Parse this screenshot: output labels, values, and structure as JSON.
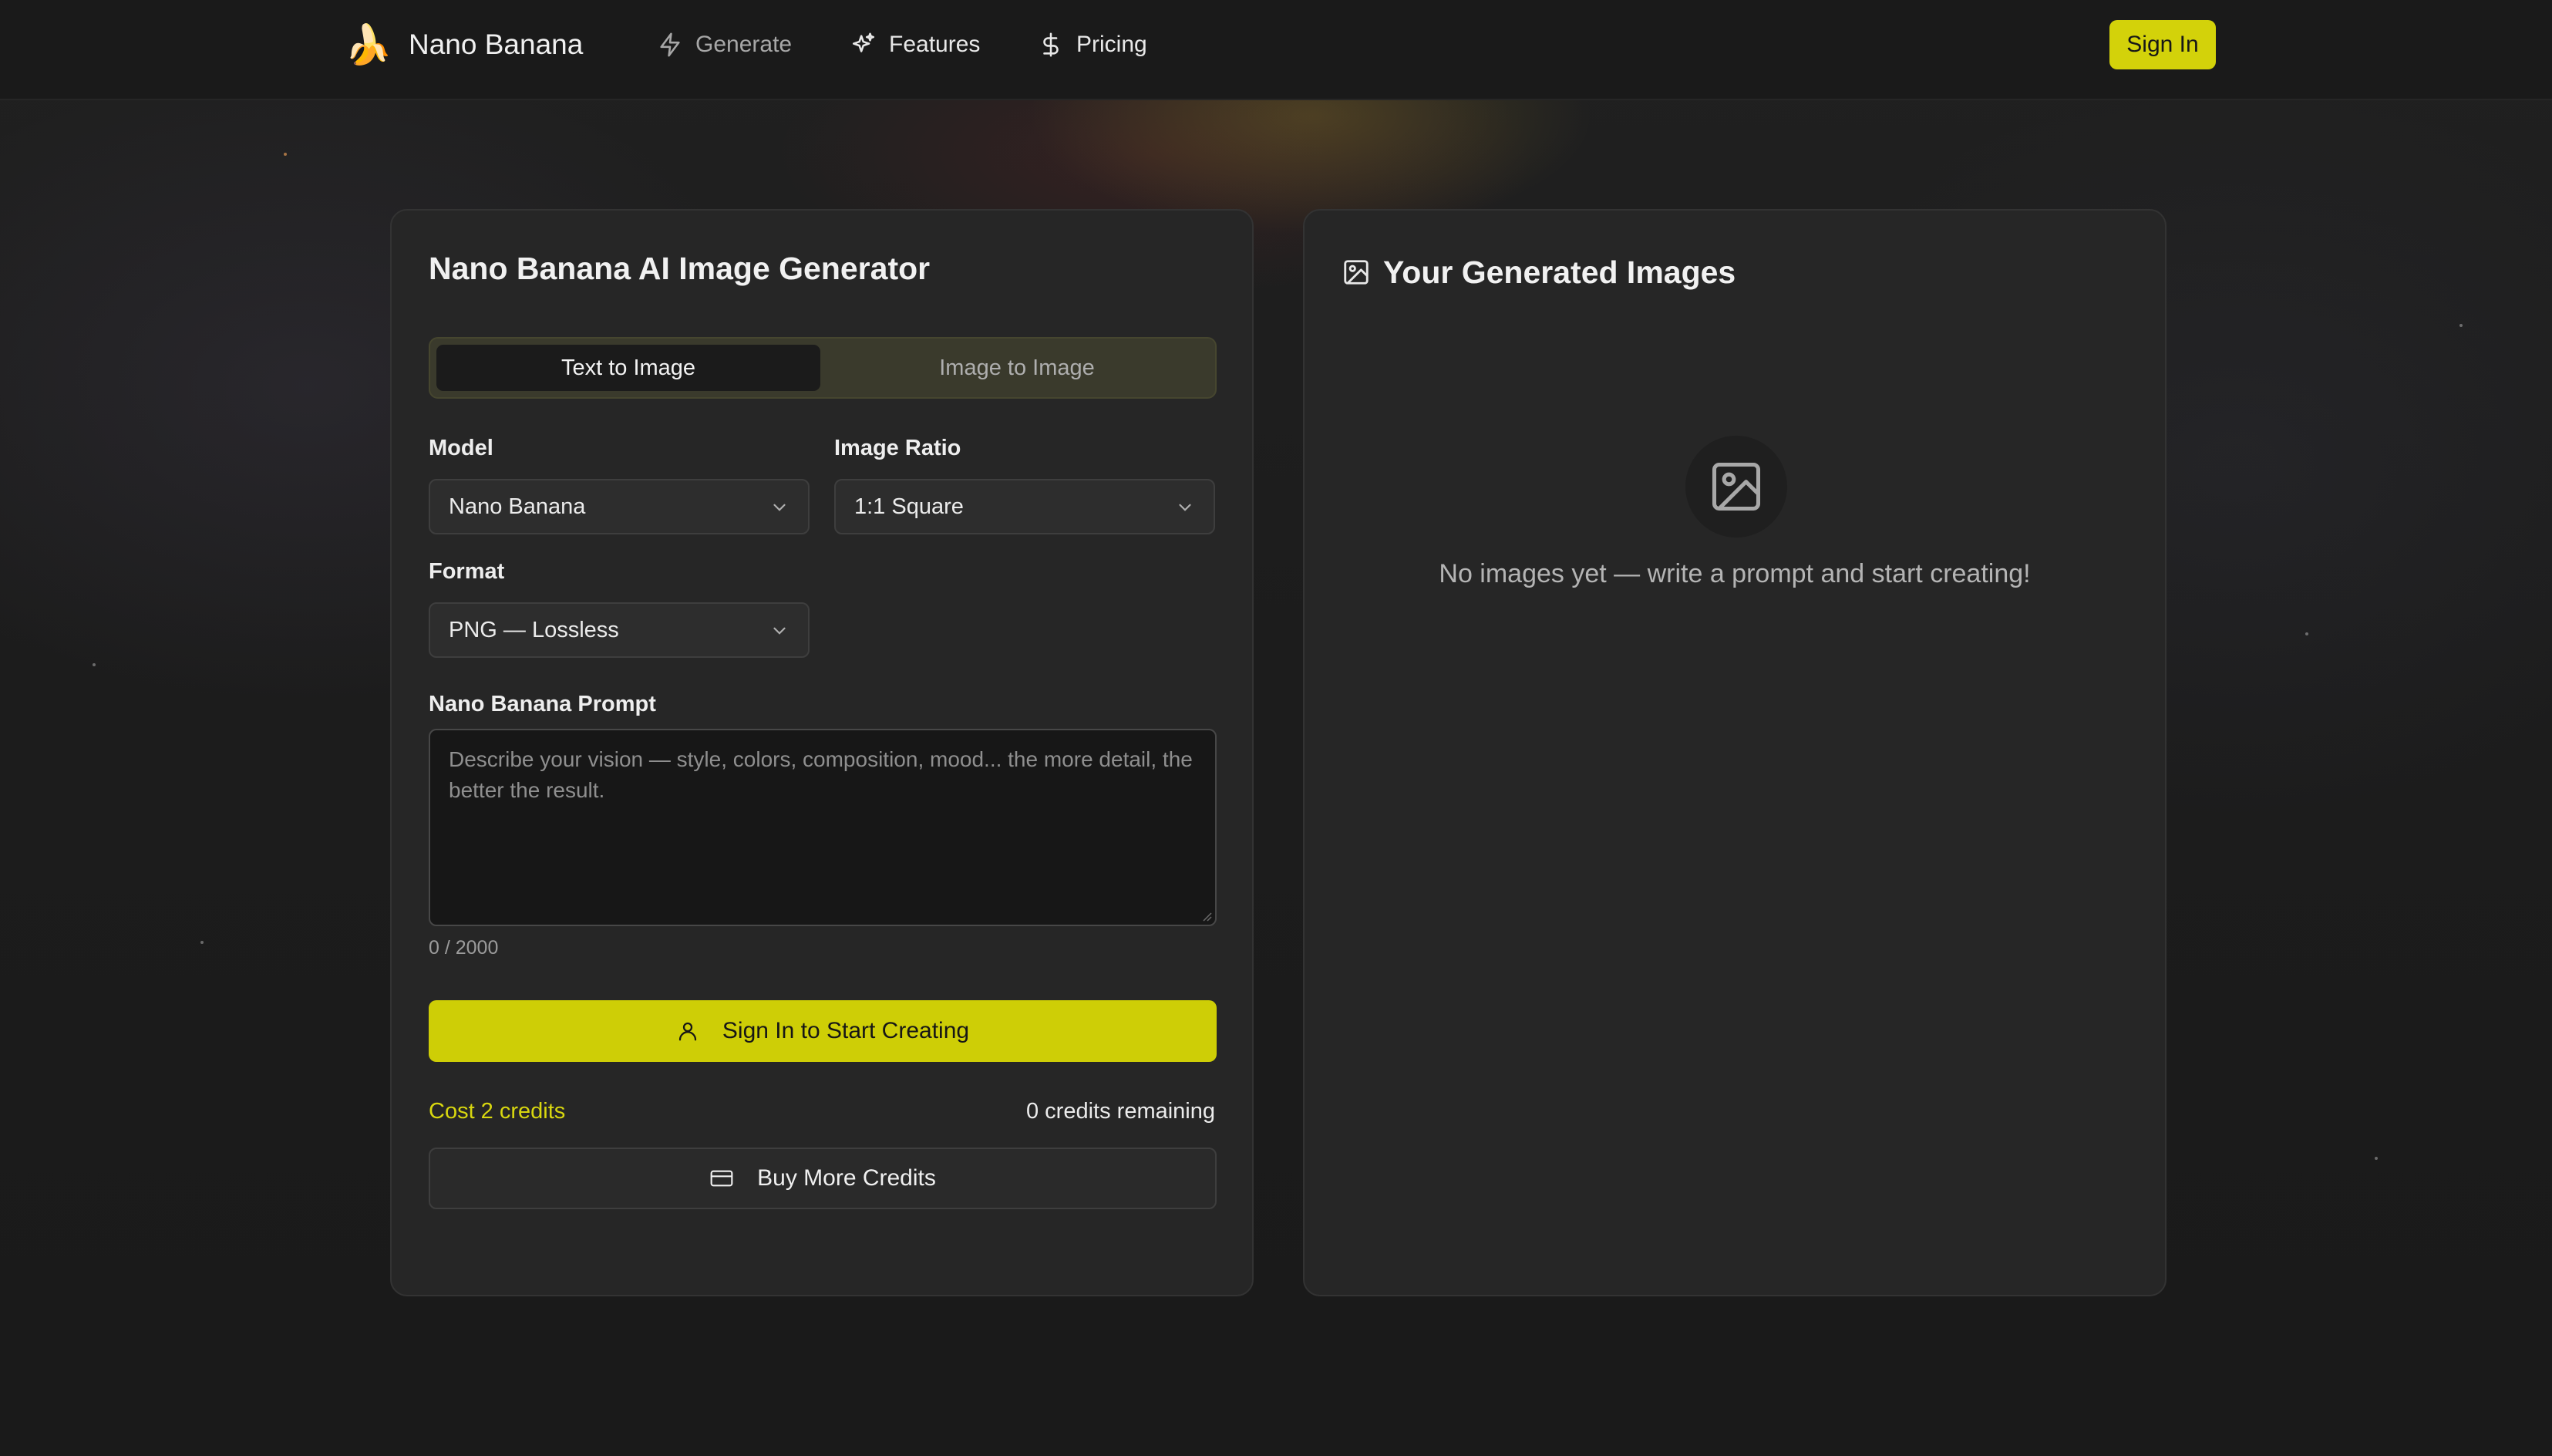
{
  "nav": {
    "brand_name": "Nano Banana",
    "brand_logo": "🍌",
    "links": [
      {
        "label": "Generate",
        "icon": "lightning-icon"
      },
      {
        "label": "Features",
        "icon": "sparkles-icon"
      },
      {
        "label": "Pricing",
        "icon": "dollar-icon"
      }
    ],
    "sign_in_label": "Sign In"
  },
  "generator": {
    "title": "Nano Banana AI Image Generator",
    "tabs": [
      {
        "label": "Text to Image",
        "active": true
      },
      {
        "label": "Image to Image",
        "active": false
      }
    ],
    "model": {
      "label": "Model",
      "value": "Nano Banana"
    },
    "ratio": {
      "label": "Image Ratio",
      "value": "1:1 Square"
    },
    "format": {
      "label": "Format",
      "value": "PNG — Lossless"
    },
    "prompt": {
      "label": "Nano Banana Prompt",
      "placeholder": "Describe your vision — style, colors, composition, mood... the more detail, the better the result.",
      "value": "",
      "counter": "0 / 2000"
    },
    "cta_label": "Sign In to Start Creating",
    "cost": "Cost 2 credits",
    "remaining": "0 credits remaining",
    "buy_label": "Buy More Credits"
  },
  "gallery": {
    "title": "Your Generated Images",
    "empty_text": "No images yet — write a prompt and start creating!"
  },
  "colors": {
    "accent": "#cece06",
    "background": "#1b1b1b",
    "card": "#262626"
  }
}
